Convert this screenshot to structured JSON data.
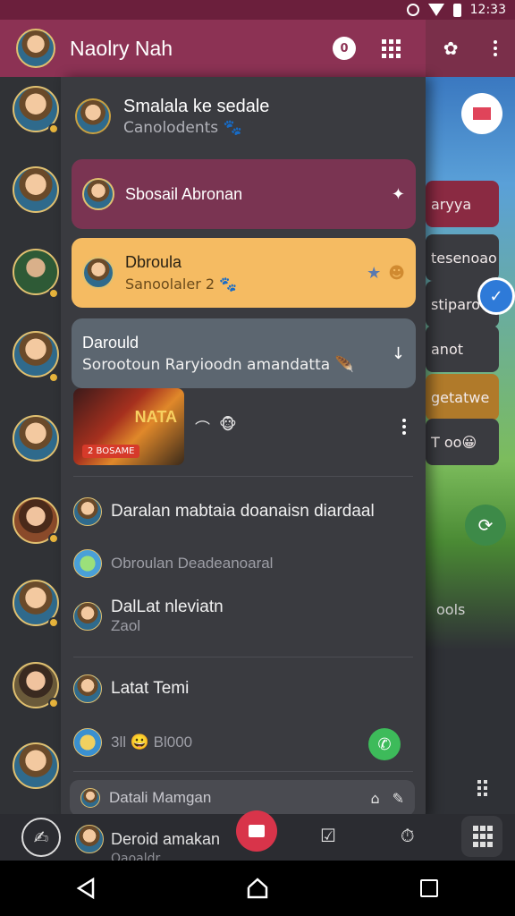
{
  "status_bar": {
    "time": "12:33"
  },
  "app_bar": {
    "title": "Naolry Nah",
    "notification_count": "0"
  },
  "drawer": {
    "account": {
      "name": "Smalala ke sedale",
      "subtitle": "Canolodents 🐾"
    },
    "cards": [
      {
        "title": "Sbosail Abronan",
        "subtitle": "",
        "color": "#7a3452"
      },
      {
        "title": "Dbroula",
        "subtitle": "Sanoolaler 2 🐾",
        "color": "#f5bb62"
      },
      {
        "title": "Darould",
        "subtitle": "Sorootoun Raryioodn amandatta 🪶",
        "color": "#5c6670"
      }
    ],
    "game": {
      "title": "NATA",
      "badge": "2 BOSAME",
      "icon_text": "🐵"
    },
    "list": [
      {
        "main": "Daralan mabtaia doanaisn diardaal",
        "sub": ""
      },
      {
        "main": "",
        "sub": "Obroulan Deadeanoaral"
      },
      {
        "main": "DalLat nleviatn",
        "sub": "Zaol"
      },
      {
        "main": "Latat Temi",
        "sub": ""
      },
      {
        "main": "",
        "sub": "3ll 😀 Bl000"
      }
    ],
    "search": {
      "placeholder": "Datali Mamgan"
    }
  },
  "background": {
    "cards": [
      "aryya",
      "tesenoao",
      "stiparo",
      "anot",
      "getatwe",
      "T oo😀"
    ],
    "label": "ools"
  },
  "bottom": {
    "label": "Deroid amakan",
    "sublabel": "Oaoaldr ..."
  },
  "colors": {
    "accent": "#8c3254",
    "drawer_bg": "#3a3b40",
    "call_green": "#3dbb5a",
    "fab_red": "#d8344a"
  }
}
